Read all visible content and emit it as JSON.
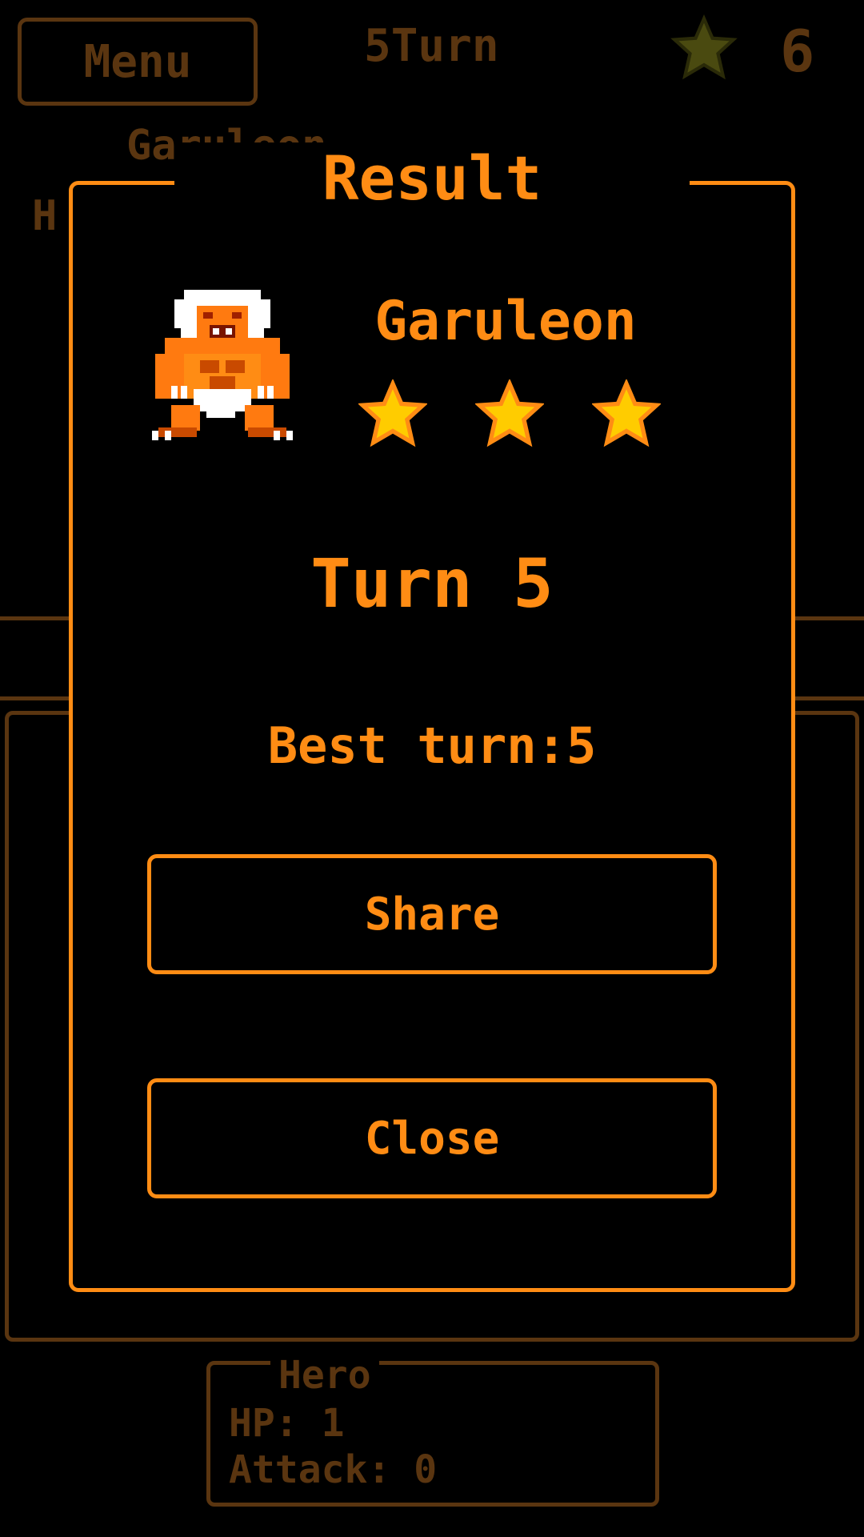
{
  "header": {
    "menu_label": "Menu",
    "turn_counter": "5Turn",
    "star_count": "6",
    "star_icon": "star-icon"
  },
  "background": {
    "enemy_name": "Garuleon",
    "enemy_hp_partial": "H"
  },
  "hero_panel": {
    "title": "Hero",
    "hp": "HP: 1",
    "attack": "Attack: 0"
  },
  "result": {
    "title": "Result",
    "monster_name": "Garuleon",
    "stars_earned": 3,
    "stars_total": 3,
    "turn_text": "Turn 5",
    "best_text": "Best turn:5",
    "share_label": "Share",
    "close_label": "Close"
  },
  "colors": {
    "accent": "#ff8c14",
    "dim": "#5a3510",
    "star_fill": "#ffcc00",
    "background": "#000000"
  }
}
